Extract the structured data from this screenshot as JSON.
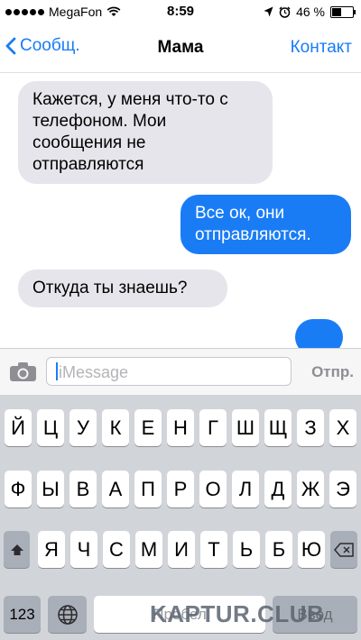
{
  "status_bar": {
    "carrier": "MegaFon",
    "time": "8:59",
    "battery": "46 %",
    "battery_level": 0.46,
    "icons": [
      "signal-dots-icon",
      "wifi-icon",
      "location-arrow-icon",
      "alarm-icon",
      "battery-icon"
    ]
  },
  "nav": {
    "back_label": "Сообщ.",
    "title": "Мама",
    "contact_label": "Контакт"
  },
  "messages": [
    {
      "direction": "incoming",
      "text": "Кажется, у меня что-то с телефоном. Мои сообщения не отправляются"
    },
    {
      "direction": "outgoing",
      "text": "Все ок, они отправляются."
    },
    {
      "direction": "incoming",
      "text": "Откуда ты знаешь?"
    },
    {
      "direction": "outgoing",
      "text": ""
    }
  ],
  "input": {
    "placeholder": "iMessage",
    "send_label": "Отпр."
  },
  "keyboard": {
    "row1": [
      "Й",
      "Ц",
      "У",
      "К",
      "Е",
      "Н",
      "Г",
      "Ш",
      "Щ",
      "З",
      "Х"
    ],
    "row2": [
      "Ф",
      "Ы",
      "В",
      "А",
      "П",
      "Р",
      "О",
      "Л",
      "Д",
      "Ж",
      "Э"
    ],
    "row3": [
      "Я",
      "Ч",
      "С",
      "М",
      "И",
      "Т",
      "Ь",
      "Б",
      "Ю"
    ],
    "numbers_label": "123",
    "space_label": "Пробел",
    "return_label": "Ввод"
  },
  "watermark": "KAPTUR.CLUB",
  "colors": {
    "accent": "#1a7cf5",
    "incoming_bubble": "#e6e5eb",
    "keyboard_bg": "#d1d4d9"
  }
}
